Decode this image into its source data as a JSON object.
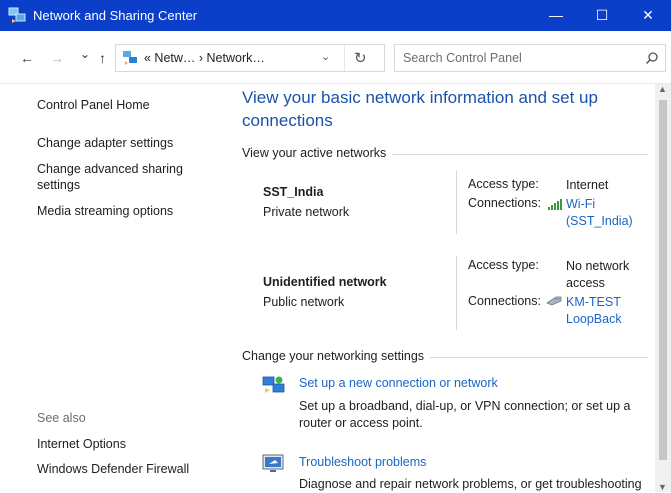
{
  "window": {
    "title": "Network and Sharing Center",
    "controls": {
      "minimize": "—",
      "maximize": "☐",
      "close": "✕"
    }
  },
  "toolbar": {
    "back": "←",
    "forward": "→",
    "recent": "⌄",
    "up": "↑",
    "address": {
      "crumbs": "« Netw… › Network…",
      "dropdown": "⌄",
      "refresh": "↻"
    },
    "search": {
      "placeholder": "Search Control Panel",
      "value": ""
    }
  },
  "sidebar": {
    "items": [
      {
        "label": "Control Panel Home"
      },
      {
        "label": "Change adapter settings"
      },
      {
        "label": "Change advanced sharing settings",
        "line1": "Change advanced sharing",
        "line2": "settings"
      },
      {
        "label": "Media streaming options"
      }
    ],
    "see_also": {
      "heading": "See also",
      "items": [
        {
          "label": "Internet Options"
        },
        {
          "label": "Windows Defender Firewall"
        }
      ]
    }
  },
  "main": {
    "heading_line1": "View your basic network information and set up",
    "heading_line2": "connections",
    "active_networks_label": "View your active networks",
    "networks": [
      {
        "name": "SST_India",
        "type": "Private network",
        "access_type_label": "Access type:",
        "access_type": "Internet",
        "connections_label": "Connections:",
        "connection_line1": "Wi-Fi",
        "connection_line2": "(SST_India)"
      },
      {
        "name": "Unidentified network",
        "type": "Public network",
        "access_type_label": "Access type:",
        "access_type_line1": "No network",
        "access_type_line2": "access",
        "connections_label": "Connections:",
        "connection_line1": "KM-TEST",
        "connection_line2": "LoopBack"
      }
    ],
    "change_settings_label": "Change your networking settings",
    "tasks": [
      {
        "link": "Set up a new connection or network",
        "desc_line1": "Set up a broadband, dial-up, or VPN connection; or set up a",
        "desc_line2": "router or access point."
      },
      {
        "link": "Troubleshoot problems",
        "desc_line1": "Diagnose and repair network problems, or get troubleshooting"
      }
    ]
  },
  "colors": {
    "titlebar": "#0b3ec9",
    "link": "#1a66c4",
    "heading": "#1a52a8"
  },
  "icons": {
    "app": "network-center-icon",
    "search": "search-icon",
    "wifi": "wifi-signal-icon",
    "ethernet": "ethernet-cable-icon",
    "new_connection": "new-connection-icon",
    "troubleshoot": "troubleshoot-icon"
  }
}
